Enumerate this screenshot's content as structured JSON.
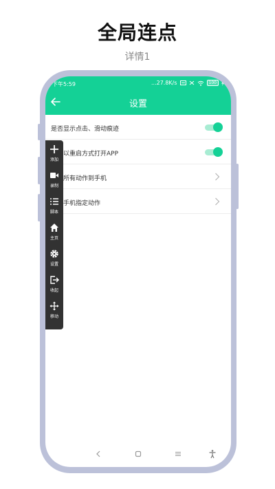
{
  "headline": "全局连点",
  "subhead": "详情1",
  "status": {
    "time": "下午5:59",
    "speed": "...27.8K/s",
    "battery": "100"
  },
  "header": {
    "title": "设置"
  },
  "settings": [
    {
      "label": "是否显示点击、滑动痕迹",
      "control": "toggle",
      "on": true
    },
    {
      "label": "是否以重启方式打开APP",
      "control": "toggle",
      "on": true
    },
    {
      "label": "导出所有动作到手机",
      "control": "chevron"
    },
    {
      "label": "导入手机指定动作",
      "control": "chevron"
    }
  ],
  "floatbar": {
    "items": [
      {
        "label": "添加",
        "icon": "plus-icon"
      },
      {
        "label": "录制",
        "icon": "record-icon"
      },
      {
        "label": "脚本",
        "icon": "list-icon"
      },
      {
        "label": "主页",
        "icon": "home-icon"
      },
      {
        "label": "设置",
        "icon": "gear-icon"
      },
      {
        "label": "收起",
        "icon": "exit-icon"
      },
      {
        "label": "移动",
        "icon": "move-icon"
      }
    ]
  },
  "colors": {
    "accent": "#14d196",
    "frame": "#bcc1d9",
    "floatbar": "#323232"
  }
}
